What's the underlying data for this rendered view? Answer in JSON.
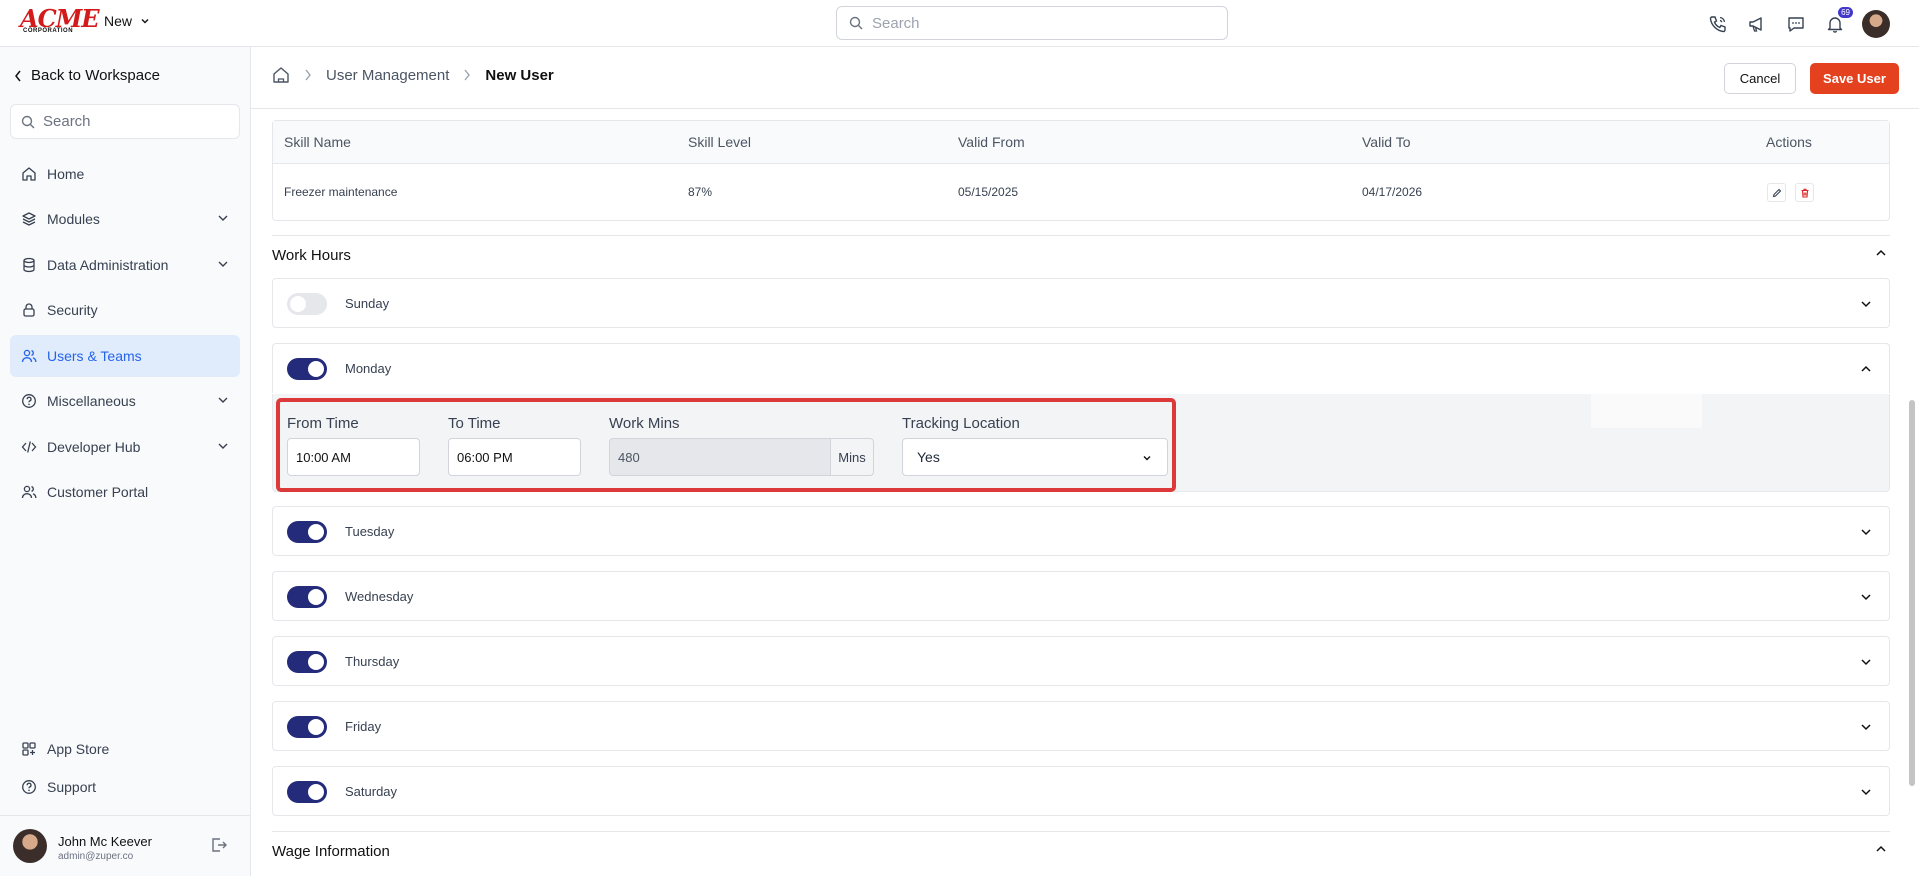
{
  "brand": {
    "logo_main": "ACME",
    "logo_sub": "CORPORATION"
  },
  "topbar": {
    "new_label": "New",
    "search_placeholder": "Search",
    "notification_count": "69",
    "icons": [
      "phone-icon",
      "megaphone-icon",
      "chat-icon",
      "bell-icon"
    ]
  },
  "sidebar": {
    "back_label": "Back to Workspace",
    "search_placeholder": "Search",
    "items": [
      {
        "label": "Home",
        "icon": "home-icon",
        "expandable": false
      },
      {
        "label": "Modules",
        "icon": "layers-icon",
        "expandable": true
      },
      {
        "label": "Data Administration",
        "icon": "database-icon",
        "expandable": true
      },
      {
        "label": "Security",
        "icon": "lock-icon",
        "expandable": false
      },
      {
        "label": "Users & Teams",
        "icon": "users-icon",
        "expandable": false,
        "active": true
      },
      {
        "label": "Miscellaneous",
        "icon": "help-circle-icon",
        "expandable": true
      },
      {
        "label": "Developer Hub",
        "icon": "code-icon",
        "expandable": true
      },
      {
        "label": "Customer Portal",
        "icon": "users-icon",
        "expandable": false
      }
    ],
    "bottom_items": [
      {
        "label": "App Store",
        "icon": "grid-icon"
      },
      {
        "label": "Support",
        "icon": "help-circle-icon"
      }
    ],
    "user": {
      "name": "John Mc Keever",
      "email": "admin@zuper.co"
    }
  },
  "header": {
    "breadcrumb": [
      "User Management",
      "New User"
    ],
    "cancel_label": "Cancel",
    "save_label": "Save User"
  },
  "skills_table": {
    "columns": [
      "Skill Name",
      "Skill Level",
      "Valid From",
      "Valid To",
      "Actions"
    ],
    "rows": [
      {
        "skill_name": "Freezer maintenance",
        "skill_level": "87%",
        "valid_from": "05/15/2025",
        "valid_to": "04/17/2026"
      }
    ]
  },
  "work_hours": {
    "title": "Work Hours",
    "days": [
      {
        "name": "Sunday",
        "enabled": false,
        "expanded": false
      },
      {
        "name": "Monday",
        "enabled": true,
        "expanded": true
      },
      {
        "name": "Tuesday",
        "enabled": true,
        "expanded": false
      },
      {
        "name": "Wednesday",
        "enabled": true,
        "expanded": false
      },
      {
        "name": "Thursday",
        "enabled": true,
        "expanded": false
      },
      {
        "name": "Friday",
        "enabled": true,
        "expanded": false
      },
      {
        "name": "Saturday",
        "enabled": true,
        "expanded": false
      }
    ],
    "monday_form": {
      "from_time_label": "From Time",
      "from_time_value": "10:00 AM",
      "to_time_label": "To Time",
      "to_time_value": "06:00 PM",
      "work_mins_label": "Work Mins",
      "work_mins_value": "480",
      "work_mins_suffix": "Mins",
      "tracking_label": "Tracking Location",
      "tracking_value": "Yes"
    }
  },
  "wage": {
    "title": "Wage Information"
  },
  "colors": {
    "accent": "#e4411f",
    "toggle_on": "#232b7a",
    "active_nav": "#2563eb",
    "highlight": "#dc3a3a"
  }
}
